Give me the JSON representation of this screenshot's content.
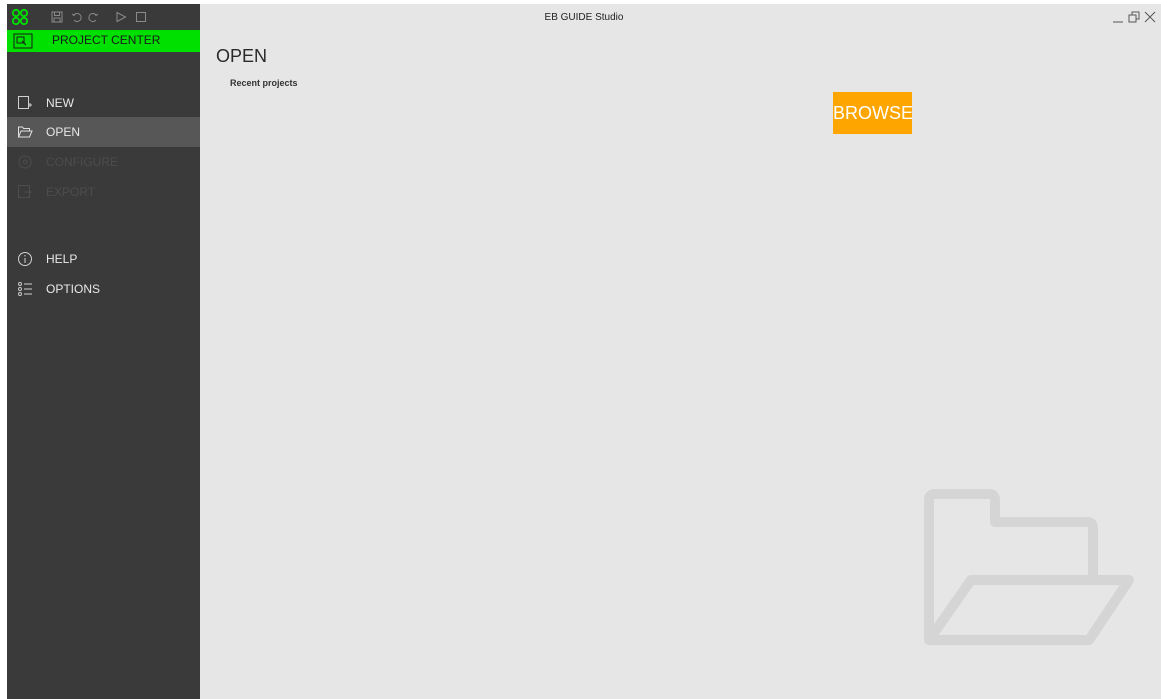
{
  "window": {
    "title": "EB GUIDE Studio"
  },
  "toolbar": {
    "icons": [
      "logo-icon",
      "save-icon",
      "undo-icon",
      "redo-icon",
      "play-icon",
      "stop-icon"
    ]
  },
  "project_center": {
    "label": "PROJECT CENTER"
  },
  "nav": {
    "new": {
      "label": "NEW",
      "icon": "new-project-icon"
    },
    "open": {
      "label": "OPEN",
      "icon": "folder-open-icon"
    },
    "configure": {
      "label": "CONFIGURE",
      "icon": "configure-icon"
    },
    "export": {
      "label": "EXPORT",
      "icon": "export-icon"
    },
    "help": {
      "label": "HELP",
      "icon": "info-icon"
    },
    "options": {
      "label": "OPTIONS",
      "icon": "options-list-icon"
    }
  },
  "main": {
    "title": "OPEN",
    "recent_label": "Recent projects",
    "browse_label": "BROWSE"
  },
  "colors": {
    "sidebar": "#3a3a3a",
    "active_item": "#575757",
    "accent_green": "#00e000",
    "browse_orange": "#ffa500",
    "content_bg": "#e6e6e6"
  }
}
